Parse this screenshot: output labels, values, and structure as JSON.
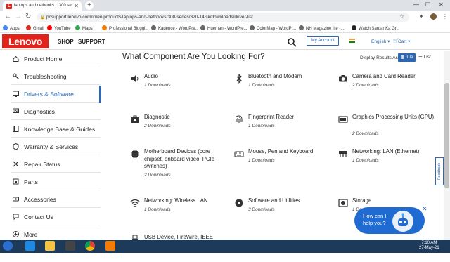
{
  "browser": {
    "tab_title": "laptops and netbooks :: 300 se...",
    "tab_favicon": "L",
    "url": "pcsupport.lenovo.com/in/en/products/laptops-and-netbooks/300-series/320-14isk/downloads/driver-list",
    "new_tab": "+",
    "bookmarks": [
      {
        "label": "Apps",
        "color": "#4285f4"
      },
      {
        "label": "Gmail",
        "color": "#d93025"
      },
      {
        "label": "YouTube",
        "color": "#ff0000"
      },
      {
        "label": "Maps",
        "color": "#34a853"
      },
      {
        "label": "Professional Bloggi...",
        "color": "#f57c00"
      },
      {
        "label": "Kadence - WordPre...",
        "color": "#666666"
      },
      {
        "label": "Hueman - WordPre...",
        "color": "#666666"
      },
      {
        "label": "ColorMag - WordPr...",
        "color": "#666666"
      },
      {
        "label": "NH Magazine lite -...",
        "color": "#666666"
      },
      {
        "label": "Watch Sardar Ka Gr...",
        "color": "#222222"
      }
    ]
  },
  "header": {
    "logo": "Lenovo",
    "nav": [
      "SHOP",
      "SUPPORT"
    ],
    "my_account": "My Account",
    "language": "English ▾",
    "cart": "Cart ▾"
  },
  "sidebar": {
    "items": [
      {
        "label": "Product Home",
        "icon": "home-icon"
      },
      {
        "label": "Troubleshooting",
        "icon": "wrench-icon"
      },
      {
        "label": "Drivers & Software",
        "icon": "monitor-icon",
        "active": true
      },
      {
        "label": "Diagnostics",
        "icon": "diagnostic-icon"
      },
      {
        "label": "Knowledge Base & Guides",
        "icon": "book-icon"
      },
      {
        "label": "Warranty & Services",
        "icon": "shield-icon"
      },
      {
        "label": "Repair Status",
        "icon": "tools-icon"
      },
      {
        "label": "Parts",
        "icon": "parts-icon"
      },
      {
        "label": "Accessories",
        "icon": "accessories-icon"
      },
      {
        "label": "Contact Us",
        "icon": "chat-icon"
      },
      {
        "label": "More",
        "icon": "more-icon"
      }
    ]
  },
  "main": {
    "title": "What Component Are You Looking For?",
    "display_label": "Display Results As:",
    "tile_label": "Tile",
    "list_label": "List",
    "components": [
      {
        "title": "Audio",
        "count": "1 Downloads",
        "icon": "speaker-icon"
      },
      {
        "title": "Bluetooth and Modem",
        "count": "1 Downloads",
        "icon": "bluetooth-icon"
      },
      {
        "title": "Camera and Card Reader",
        "count": "2 Downloads",
        "icon": "camera-icon"
      },
      {
        "title": "Diagnostic",
        "count": "2 Downloads",
        "icon": "toolbox-icon"
      },
      {
        "title": "Fingerprint Reader",
        "count": "1 Downloads",
        "icon": "fingerprint-icon"
      },
      {
        "title": "Graphics Processing Units (GPU)",
        "count": "2 Downloads",
        "icon": "gpu-icon"
      },
      {
        "title": "Motherboard Devices (core chipset, onboard video, PCIe switches)",
        "count": "2 Downloads",
        "icon": "chip-icon"
      },
      {
        "title": "Mouse, Pen and Keyboard",
        "count": "1 Downloads",
        "icon": "keyboard-icon"
      },
      {
        "title": "Networking: LAN (Ethernet)",
        "count": "1 Downloads",
        "icon": "lan-icon"
      },
      {
        "title": "Networking: Wireless LAN",
        "count": "1 Downloads",
        "icon": "wifi-icon"
      },
      {
        "title": "Software and Utilities",
        "count": "3 Downloads",
        "icon": "software-icon"
      },
      {
        "title": "Storage",
        "count": "1 Downloads",
        "icon": "storage-icon"
      },
      {
        "title": "USB Device, FireWire, IEEE",
        "count": "",
        "icon": "usb-icon"
      }
    ]
  },
  "feedback": "Feedback",
  "chat": {
    "line1": "How can I",
    "line2": "help you?",
    "close": "✕"
  },
  "taskbar": {
    "time": "7:10 AM",
    "date": "27-May-21"
  }
}
